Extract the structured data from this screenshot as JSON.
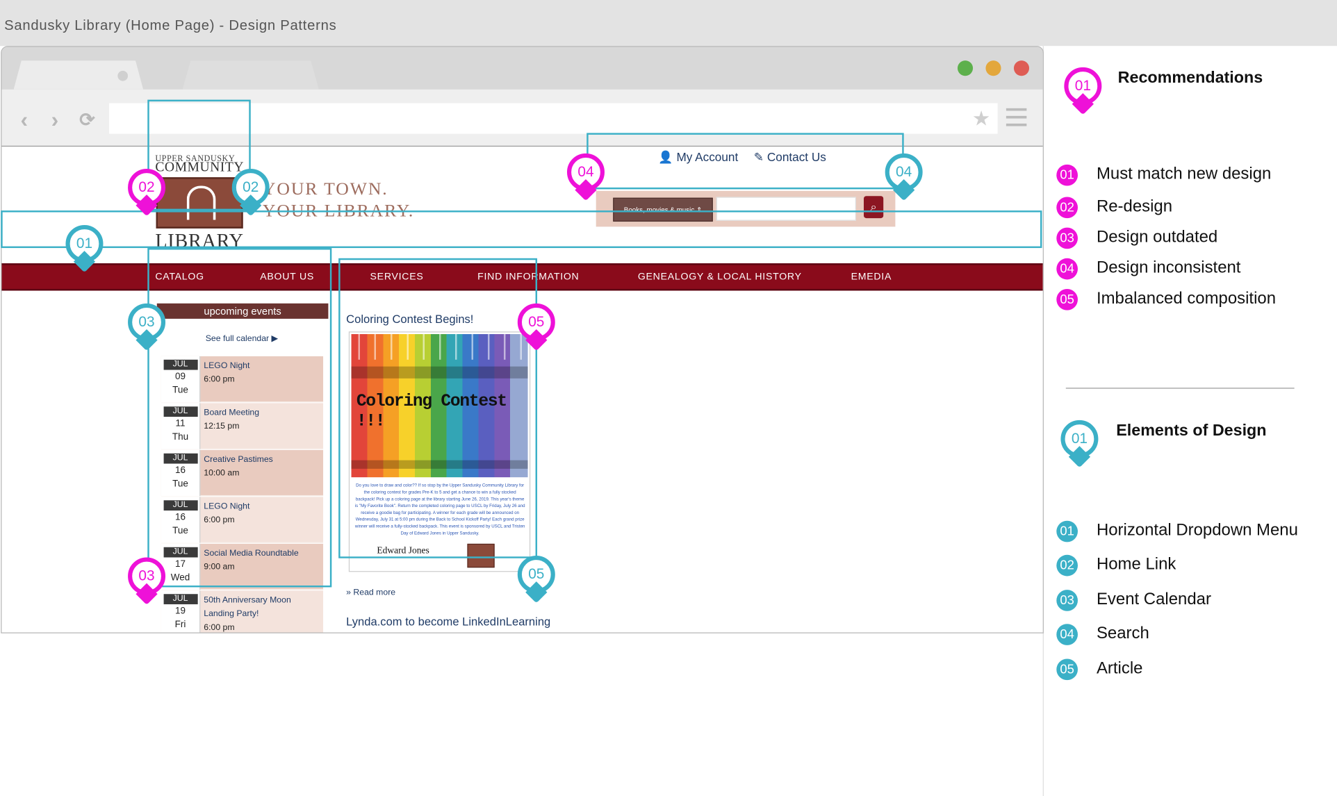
{
  "document_title": "Sandusky Library (Home Page) - Design Patterns",
  "colors": {
    "recommendation_pin": "#ee11d8",
    "element_pin": "#3bb0c7",
    "nav_bar": "#8a0b1b",
    "link": "#1f3b66"
  },
  "browser": {
    "traffic_lights": [
      "#5db04c",
      "#e3a73c",
      "#de5c54"
    ],
    "icons": [
      "back-icon",
      "forward-icon",
      "reload-icon",
      "bookmark-star-icon",
      "menu-icon"
    ],
    "url": ""
  },
  "site": {
    "logo": {
      "line1": "UPPER SANDUSKY",
      "line2": "COMMUNITY",
      "line3": "LIBRARY"
    },
    "tagline": {
      "line1": "YOUR TOWN.",
      "line2": "YOUR LIBRARY."
    },
    "utility": {
      "account": "My Account",
      "contact": "Contact Us"
    },
    "search": {
      "select_value": "Books, movies & music",
      "placeholder": ""
    },
    "nav": [
      "CATALOG",
      "ABOUT US",
      "SERVICES",
      "FIND INFORMATION",
      "GENEALOGY & LOCAL HISTORY",
      "EMEDIA"
    ],
    "events": {
      "heading": "upcoming events",
      "calendar_link": "See full calendar ▶",
      "items": [
        {
          "month": "JUL",
          "day": "09",
          "weekday": "Tue",
          "title": "LEGO Night",
          "time": "6:00 pm"
        },
        {
          "month": "JUL",
          "day": "11",
          "weekday": "Thu",
          "title": "Board Meeting",
          "time": "12:15 pm"
        },
        {
          "month": "JUL",
          "day": "16",
          "weekday": "Tue",
          "title": "Creative Pastimes",
          "time": "10:00 am"
        },
        {
          "month": "JUL",
          "day": "16",
          "weekday": "Tue",
          "title": "LEGO Night",
          "time": "6:00 pm"
        },
        {
          "month": "JUL",
          "day": "17",
          "weekday": "Wed",
          "title": "Social Media Roundtable",
          "time": "9:00 am"
        },
        {
          "month": "JUL",
          "day": "19",
          "weekday": "Fri",
          "title": "50th Anniversary Moon Landing Party!",
          "time": "6:00 pm"
        }
      ]
    },
    "article": {
      "title": "Coloring Contest Begins!",
      "image_heading": "Coloring Contest !!!",
      "image_text": "Do you love to draw and color?? If so stop by the Upper Sandusky Community Library for the coloring contest for grades Pre-K to 5 and get a chance to win a fully stocked backpack! Pick up a coloring page at the library starting June 26, 2019. This year's theme is \"My Favorite Book\". Return the completed coloring page to USCL by Friday, July 26 and receive a goodie bag for participating. A winner for each grade will be announced on Wednesday, July 31 at 5:00 pm during the Back to School Kickoff Party! Each grand prize winner will receive a fully-stocked backpack. This event is sponsored by USCL and Tristen Day of Edward Jones in Upper Sandusky.",
      "sponsor": "Edward Jones",
      "read_more": "» Read more"
    },
    "next_article": "Lynda.com to become LinkedInLearning"
  },
  "annotations": {
    "pins": [
      {
        "num": "02",
        "kind": "recommendation"
      },
      {
        "num": "02",
        "kind": "element"
      },
      {
        "num": "04",
        "kind": "recommendation"
      },
      {
        "num": "04",
        "kind": "element"
      },
      {
        "num": "01",
        "kind": "element"
      },
      {
        "num": "03",
        "kind": "element"
      },
      {
        "num": "03",
        "kind": "recommendation"
      },
      {
        "num": "05",
        "kind": "recommendation"
      },
      {
        "num": "05",
        "kind": "element"
      }
    ]
  },
  "legend": {
    "recommendations": {
      "title": "Recommendations",
      "pin": "01",
      "items": [
        {
          "num": "01",
          "label": "Must match new design"
        },
        {
          "num": "02",
          "label": "Re-design"
        },
        {
          "num": "03",
          "label": "Design outdated"
        },
        {
          "num": "04",
          "label": "Design inconsistent"
        },
        {
          "num": "05",
          "label": "Imbalanced composition"
        }
      ]
    },
    "elements": {
      "title": "Elements of Design",
      "pin": "01",
      "items": [
        {
          "num": "01",
          "label": "Horizontal Dropdown Menu"
        },
        {
          "num": "02",
          "label": "Home Link"
        },
        {
          "num": "03",
          "label": "Event Calendar"
        },
        {
          "num": "04",
          "label": "Search"
        },
        {
          "num": "05",
          "label": "Article"
        }
      ]
    }
  }
}
